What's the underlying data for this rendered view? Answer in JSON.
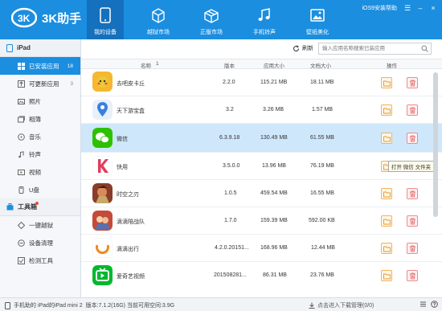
{
  "header": {
    "logo_text": "3K助手",
    "nav": [
      {
        "label": "我的设备",
        "icon": "device-icon",
        "active": true
      },
      {
        "label": "越狱市场",
        "icon": "box-icon",
        "active": false
      },
      {
        "label": "正版市场",
        "icon": "package-icon",
        "active": false
      },
      {
        "label": "手机铃声",
        "icon": "music-icon",
        "active": false
      },
      {
        "label": "壁纸美化",
        "icon": "image-icon",
        "active": false
      }
    ],
    "help_text": "iOS9安装帮助"
  },
  "sidebar": {
    "device_title": "iPad",
    "items": [
      {
        "label": "已安装应用",
        "count": "18",
        "active": true,
        "icon": "apps-icon"
      },
      {
        "label": "可更新应用",
        "count": "3",
        "active": false,
        "icon": "update-icon"
      },
      {
        "label": "照片",
        "count": "",
        "active": false,
        "icon": "photo-icon"
      },
      {
        "label": "相簿",
        "count": "",
        "active": false,
        "icon": "album-icon"
      },
      {
        "label": "音乐",
        "count": "",
        "active": false,
        "icon": "music-note-icon"
      },
      {
        "label": "铃声",
        "count": "",
        "active": false,
        "icon": "ringtone-icon"
      },
      {
        "label": "视频",
        "count": "",
        "active": false,
        "icon": "video-icon"
      },
      {
        "label": "U盘",
        "count": "",
        "active": false,
        "icon": "usb-icon"
      }
    ],
    "tools_title": "工具箱",
    "tools": [
      {
        "label": "一键越狱",
        "icon": "jailbreak-icon"
      },
      {
        "label": "设备清理",
        "icon": "clean-icon"
      },
      {
        "label": "检测工具",
        "icon": "check-icon"
      }
    ]
  },
  "toolbar": {
    "refresh_label": "刷新",
    "search_placeholder": "输入应用名称搜索已装应用"
  },
  "table": {
    "headers": {
      "name": "名称",
      "sort": "1",
      "version": "版本",
      "app_size": "应用大小",
      "doc_size": "文档大小",
      "action": "操作"
    },
    "rows": [
      {
        "name": "去吧皮卡丘",
        "version": "2.2.0",
        "app_size": "115.21 MB",
        "doc_size": "18.11 MB",
        "color": "#f5b82e",
        "selected": false
      },
      {
        "name": "天下游宝盒",
        "version": "3.2",
        "app_size": "3.26 MB",
        "doc_size": "1.57 MB",
        "color": "#3b7fe0",
        "selected": false
      },
      {
        "name": "微信",
        "version": "6.3.9.18",
        "app_size": "130.49 MB",
        "doc_size": "61.55 MB",
        "color": "#2dc100",
        "selected": true
      },
      {
        "name": "快用",
        "version": "3.5.0.0",
        "app_size": "13.96 MB",
        "doc_size": "76.19 MB",
        "color": "#e23c5a",
        "selected": false
      },
      {
        "name": "时空之刃",
        "version": "1.0.5",
        "app_size": "459.54 MB",
        "doc_size": "16.55 MB",
        "color": "#8a3c2a",
        "selected": false
      },
      {
        "name": "滴滴陪战队",
        "version": "1.7.0",
        "app_size": "159.39 MB",
        "doc_size": "592.00 KB",
        "color": "#c44a3a",
        "selected": false
      },
      {
        "name": "滴滴出行",
        "version": "4.2.0.20151...",
        "app_size": "168.96 MB",
        "doc_size": "12.44 MB",
        "color": "#f08a1c",
        "selected": false
      },
      {
        "name": "爱奇艺视频",
        "version": "201508281...",
        "app_size": "86.31 MB",
        "doc_size": "23.76 MB",
        "color": "#00b82e",
        "selected": false
      }
    ],
    "tooltip": "打开 微信 文件夹"
  },
  "status": {
    "device_info": "手机助的 iPad的iPad mini 2",
    "version_info": "版本:7.1.2(16G) 当前可用空间:3.9G",
    "downloads": "点击进入下载管理(0/0)"
  },
  "colors": {
    "accent": "#1b8ee0",
    "nav_active": "#1570bd",
    "selected_row": "#cfe7fb"
  }
}
